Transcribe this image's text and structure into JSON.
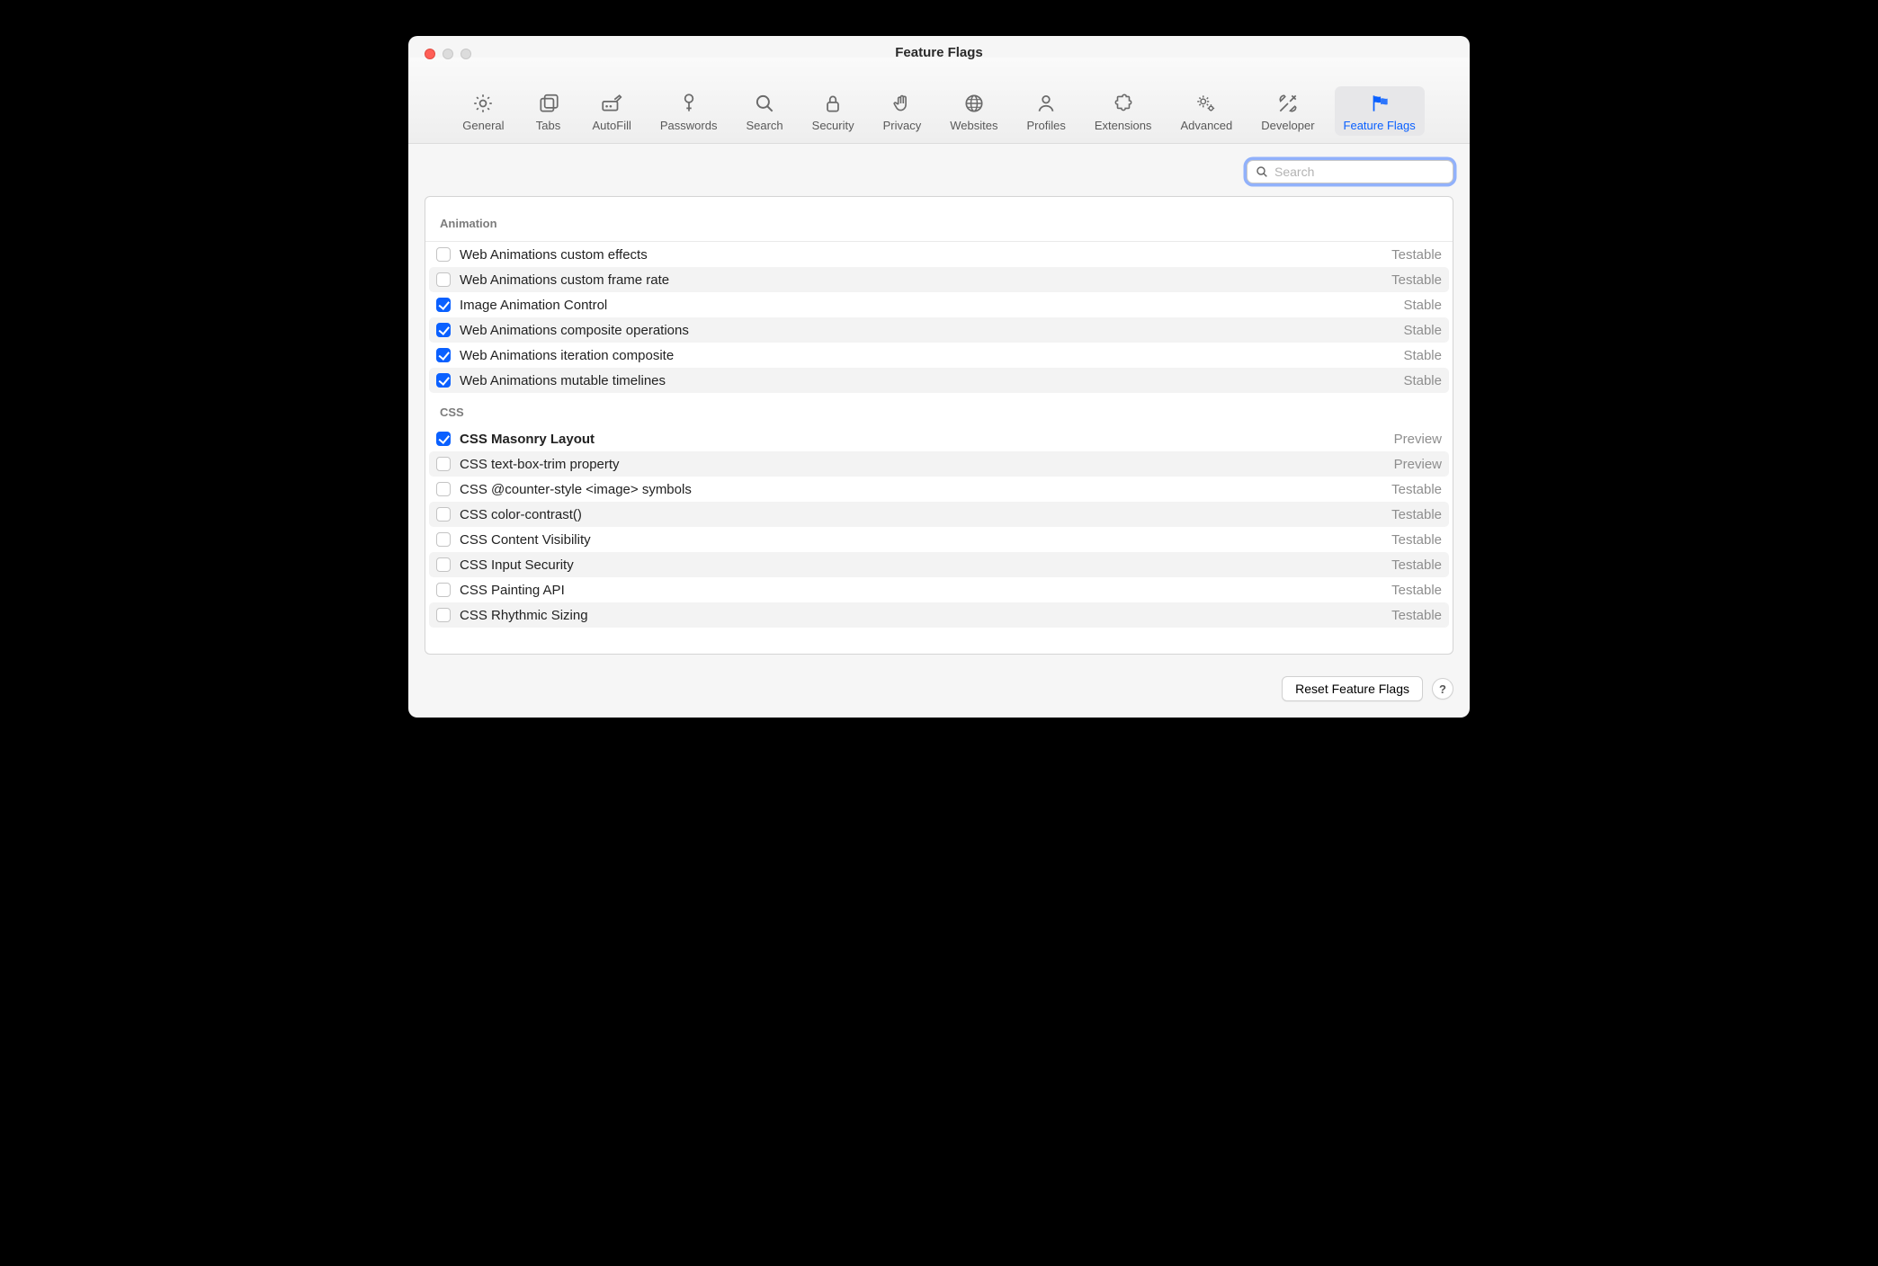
{
  "window": {
    "title": "Feature Flags"
  },
  "toolbar": {
    "items": [
      {
        "label": "General",
        "icon": "gear"
      },
      {
        "label": "Tabs",
        "icon": "tabs"
      },
      {
        "label": "AutoFill",
        "icon": "autofill"
      },
      {
        "label": "Passwords",
        "icon": "key"
      },
      {
        "label": "Search",
        "icon": "search"
      },
      {
        "label": "Security",
        "icon": "lock"
      },
      {
        "label": "Privacy",
        "icon": "hand"
      },
      {
        "label": "Websites",
        "icon": "globe"
      },
      {
        "label": "Profiles",
        "icon": "person"
      },
      {
        "label": "Extensions",
        "icon": "puzzle"
      },
      {
        "label": "Advanced",
        "icon": "gears"
      },
      {
        "label": "Developer",
        "icon": "tools"
      },
      {
        "label": "Feature Flags",
        "icon": "flags",
        "active": true
      }
    ]
  },
  "search": {
    "placeholder": "Search"
  },
  "sections": [
    {
      "title": "Animation",
      "flags": [
        {
          "name": "Web Animations custom effects",
          "checked": false,
          "status": "Testable"
        },
        {
          "name": "Web Animations custom frame rate",
          "checked": false,
          "status": "Testable"
        },
        {
          "name": "Image Animation Control",
          "checked": true,
          "status": "Stable"
        },
        {
          "name": "Web Animations composite operations",
          "checked": true,
          "status": "Stable"
        },
        {
          "name": "Web Animations iteration composite",
          "checked": true,
          "status": "Stable"
        },
        {
          "name": "Web Animations mutable timelines",
          "checked": true,
          "status": "Stable"
        }
      ]
    },
    {
      "title": "CSS",
      "flags": [
        {
          "name": "CSS Masonry Layout",
          "checked": true,
          "status": "Preview",
          "bold": true
        },
        {
          "name": "CSS text-box-trim property",
          "checked": false,
          "status": "Preview"
        },
        {
          "name": "CSS @counter-style <image> symbols",
          "checked": false,
          "status": "Testable"
        },
        {
          "name": "CSS color-contrast()",
          "checked": false,
          "status": "Testable"
        },
        {
          "name": "CSS Content Visibility",
          "checked": false,
          "status": "Testable"
        },
        {
          "name": "CSS Input Security",
          "checked": false,
          "status": "Testable"
        },
        {
          "name": "CSS Painting API",
          "checked": false,
          "status": "Testable"
        },
        {
          "name": "CSS Rhythmic Sizing",
          "checked": false,
          "status": "Testable"
        }
      ]
    }
  ],
  "footer": {
    "reset_label": "Reset Feature Flags",
    "help_label": "?"
  }
}
